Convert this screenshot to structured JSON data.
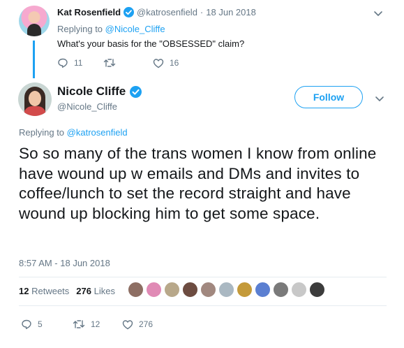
{
  "parent_tweet": {
    "name": "Kat Rosenfield",
    "handle": "@katrosenfield",
    "separator": "·",
    "date": "18 Jun 2018",
    "replying_prefix": "Replying to",
    "replying_to": "@Nicole_Cliffe",
    "text": "What's your basis for the \"OBSESSED\" claim?",
    "reply_count": "11",
    "retweet_count": "",
    "like_count": "16"
  },
  "main_tweet": {
    "name": "Nicole Cliffe",
    "handle": "@Nicole_Cliffe",
    "follow_label": "Follow",
    "replying_prefix": "Replying to",
    "replying_to": "@katrosenfield",
    "text": "So so many of the trans women I know from online have wound up w emails and DMs and invites to coffee/lunch to set the record straight and have wound up blocking him to get some space.",
    "timestamp": "8:57 AM - 18 Jun 2018",
    "retweets_count": "12",
    "retweets_label": "Retweets",
    "likes_count": "276",
    "likes_label": "Likes",
    "liker_avatar_colors": [
      "#8d6e63",
      "#e08ab5",
      "#b8a88a",
      "#6d4c41",
      "#a1887f",
      "#aab8c2",
      "#c49a3a",
      "#5b7fd1",
      "#7a7a7a",
      "#c8c8c8",
      "#3c3c3c"
    ],
    "reply_count": "5",
    "retweet_count": "12",
    "like_count": "276"
  },
  "colors": {
    "accent": "#1da1f2",
    "muted": "#657786",
    "text": "#14171a"
  }
}
